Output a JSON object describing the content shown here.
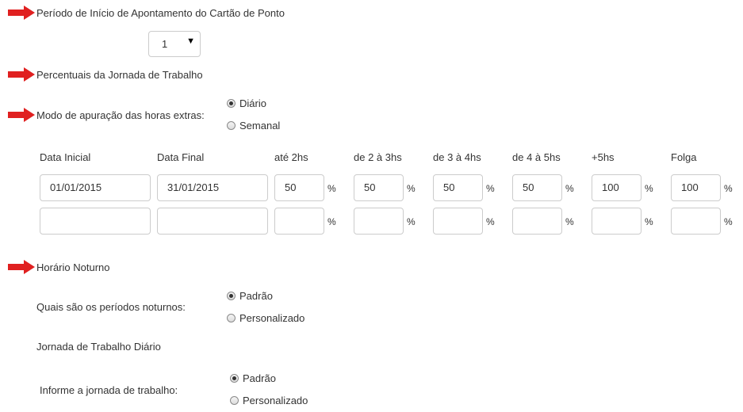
{
  "sections": {
    "periodo_inicio": {
      "title": "Período de Início de Apontamento do Cartão de Ponto",
      "select_value": "1"
    },
    "percentuais": {
      "title": "Percentuais da Jornada de Trabalho"
    },
    "modo_apuracao": {
      "label": "Modo de apuração das horas extras:",
      "options": [
        {
          "label": "Diário",
          "checked": true
        },
        {
          "label": "Semanal",
          "checked": false
        }
      ]
    },
    "table": {
      "headers": [
        "Data Inicial",
        "Data Final",
        "até 2hs",
        "de 2 à 3hs",
        "de 3 à 4hs",
        "de 4 à 5hs",
        "+5hs",
        "Folga"
      ],
      "pct_symbol": "%",
      "rows": [
        [
          "01/01/2015",
          "31/01/2015",
          "50",
          "50",
          "50",
          "50",
          "100",
          "100"
        ],
        [
          "",
          "",
          "",
          "",
          "",
          "",
          "",
          ""
        ]
      ]
    },
    "horario_noturno": {
      "title": "Horário Noturno",
      "periodos_label": "Quais são os períodos noturnos:",
      "periodos_options": [
        {
          "label": "Padrão",
          "checked": true
        },
        {
          "label": "Personalizado",
          "checked": false
        }
      ],
      "jornada_title": "Jornada de Trabalho Diário",
      "jornada_label": "Informe a jornada de trabalho:",
      "jornada_options": [
        {
          "label": "Padrão",
          "checked": true
        },
        {
          "label": "Personalizado",
          "checked": false
        }
      ]
    }
  }
}
